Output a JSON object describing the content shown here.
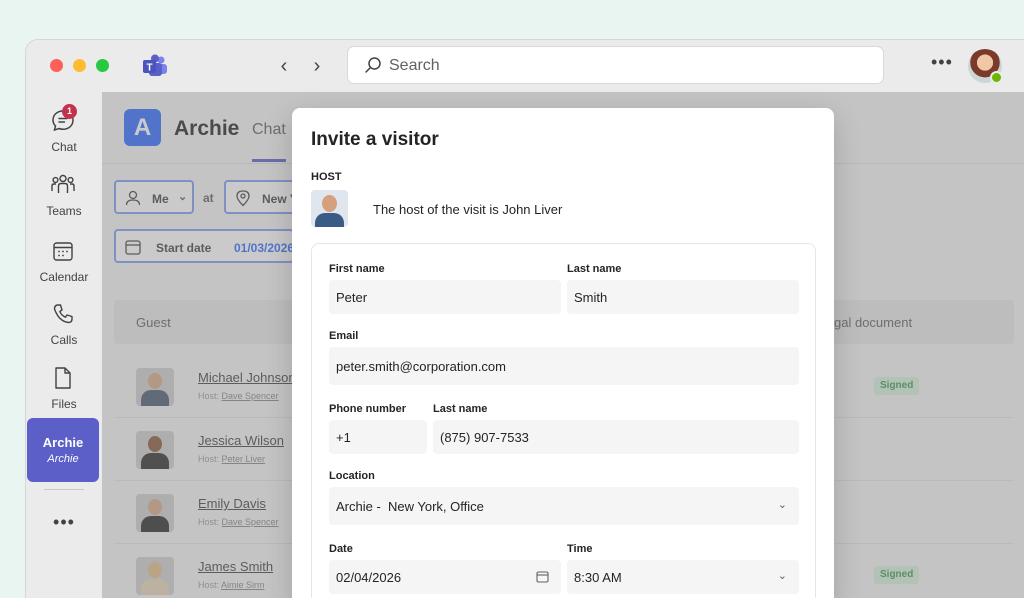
{
  "titlebar": {
    "search_placeholder": "Search",
    "more_label": "•••"
  },
  "rail": {
    "items": [
      {
        "label": "Chat",
        "badge": "1"
      },
      {
        "label": "Teams"
      },
      {
        "label": "Calendar"
      },
      {
        "label": "Calls"
      },
      {
        "label": "Files"
      }
    ],
    "active_app": {
      "title": "Archie",
      "subtitle": "Archie"
    },
    "more_label": "•••"
  },
  "app": {
    "logo_letter": "A",
    "name": "Archie",
    "tab": "Chat",
    "filters": {
      "me": "Me",
      "at": "at",
      "location": "New Y",
      "start_date_label": "Start date",
      "start_date_value": "01/03/2026"
    },
    "table": {
      "col_guest": "Guest",
      "col_doc": "gal document",
      "rows": [
        {
          "name": "Michael Johnson",
          "host_prefix": "Host:",
          "host": "Dave Spencer",
          "status": "Signed"
        },
        {
          "name": "Jessica Wilson",
          "host_prefix": "Host:",
          "host": "Peter Liver",
          "status": ""
        },
        {
          "name": "Emily Davis",
          "host_prefix": "Host:",
          "host": "Dave Spencer",
          "status": ""
        },
        {
          "name": "James Smith",
          "host_prefix": "Host:",
          "host": "Aimie Sirm",
          "status": "Signed"
        }
      ]
    }
  },
  "dialog": {
    "title": "Invite a visitor",
    "host_label": "HOST",
    "host_text": "The host of the visit is John Liver",
    "fields": {
      "first_name_label": "First name",
      "first_name_value": "Peter",
      "last_name_label": "Last name",
      "last_name_value": "Smith",
      "email_label": "Email",
      "email_value": "peter.smith@corporation.com",
      "phone_label": "Phone number",
      "phone_last_label": "Last name",
      "phone_code": "+1",
      "phone_value": "(875) 907-7533",
      "location_label": "Location",
      "location_value": "Archie -  New York, Office",
      "date_label": "Date",
      "date_value": "02/04/2026",
      "time_label": "Time",
      "time_value": "8:30 AM"
    }
  },
  "colors": {
    "brand_purple": "#5b5fc7",
    "app_blue": "#2f6bff",
    "badge_red": "#c4314b",
    "signed_green": "#3f9b52"
  }
}
